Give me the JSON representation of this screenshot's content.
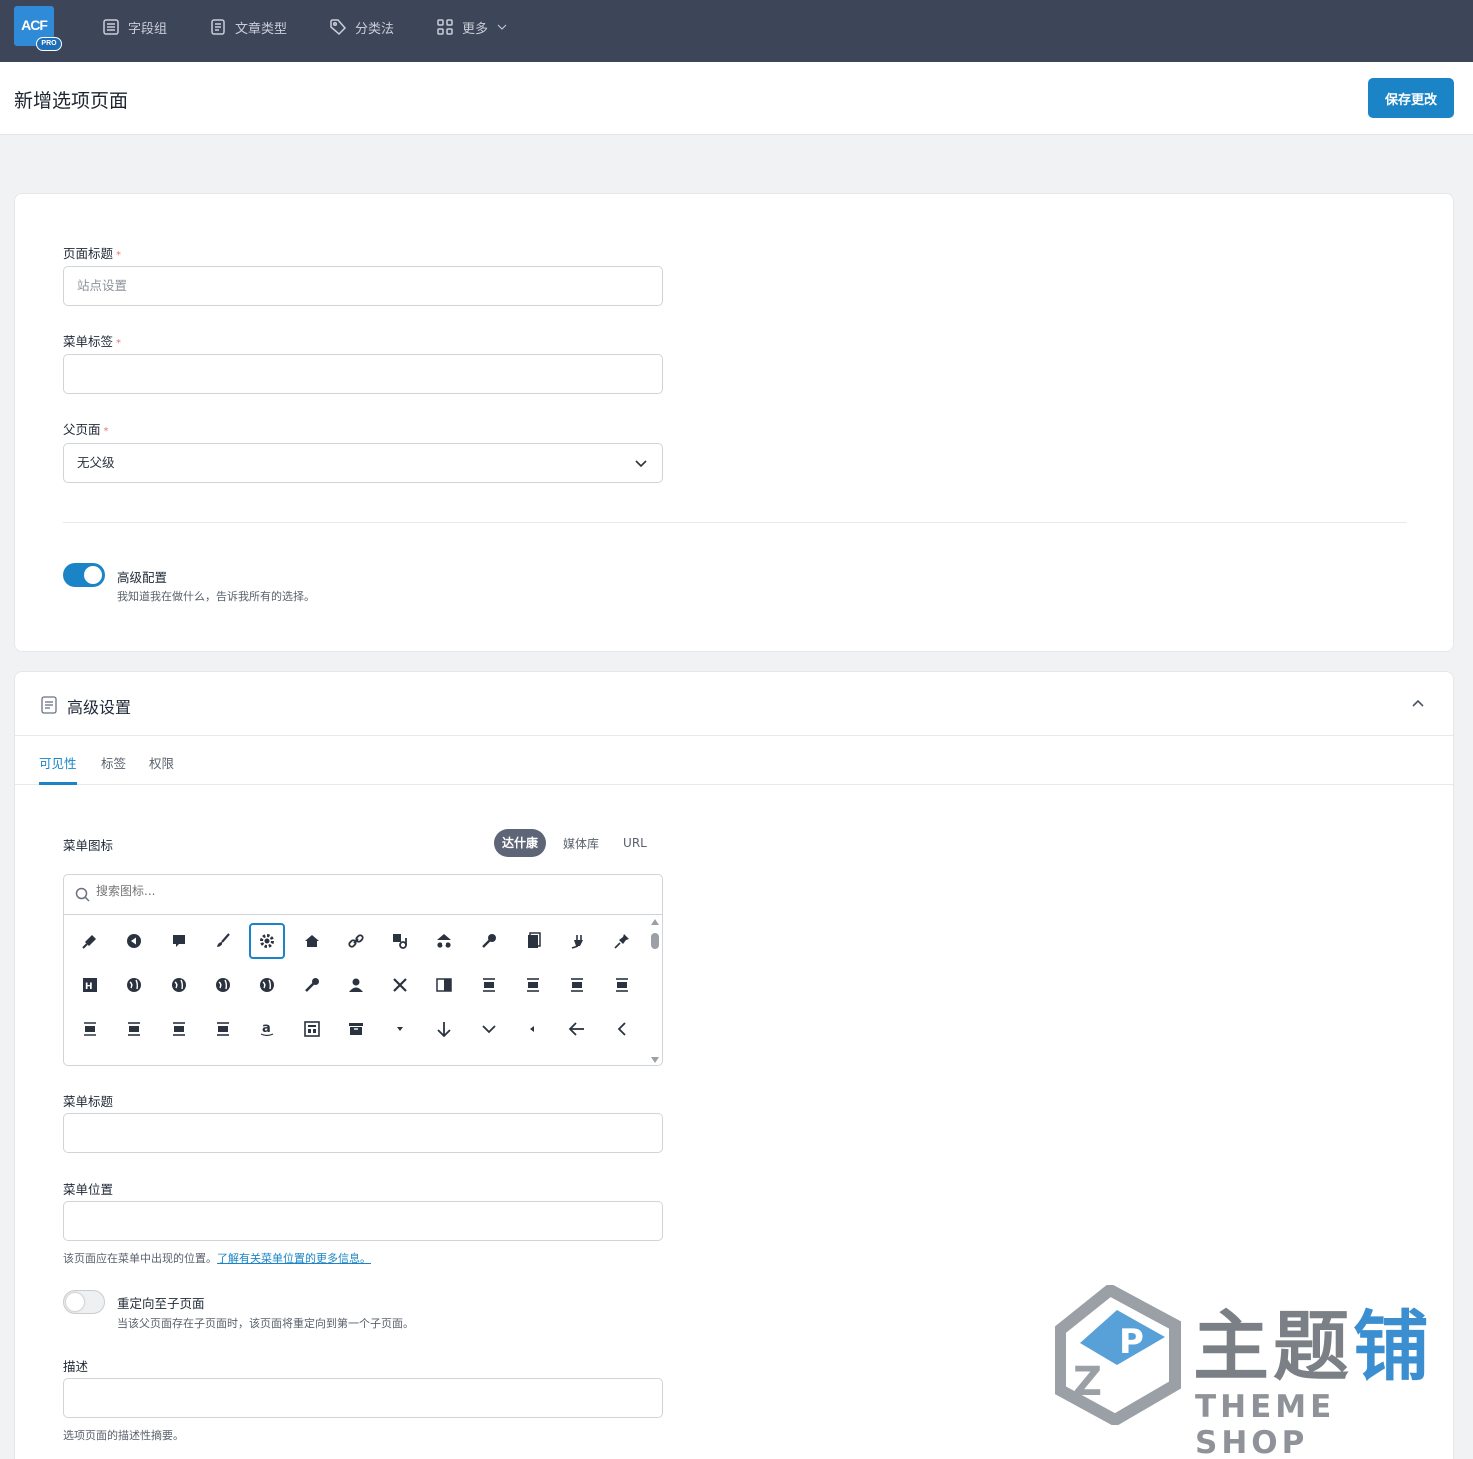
{
  "app": {
    "logo_text": "ACF",
    "logo_badge": "PRO"
  },
  "nav": [
    {
      "label": "字段组",
      "icon": "field-group-icon"
    },
    {
      "label": "文章类型",
      "icon": "post-type-icon"
    },
    {
      "label": "分类法",
      "icon": "tag-icon"
    },
    {
      "label": "更多",
      "icon": "grid-icon"
    }
  ],
  "header": {
    "title": "新增选项页面",
    "save_label": "保存更改"
  },
  "form": {
    "page_title_label": "页面标题",
    "page_title_placeholder": "站点设置",
    "menu_label_label": "菜单标签",
    "menu_label_value": "",
    "parent_label": "父页面",
    "parent_value": "无父级",
    "required_mark": "*",
    "advanced_toggle_title": "高级配置",
    "advanced_toggle_desc": "我知道我在做什么，告诉我所有的选择。",
    "advanced_toggle_on": true
  },
  "advanced": {
    "title": "高级设置",
    "tabs": [
      "可见性",
      "标签",
      "权限"
    ],
    "active_tab": 0,
    "menu_icon_label": "菜单图标",
    "icon_sources": [
      "达什康",
      "媒体库",
      "URL"
    ],
    "icon_search_placeholder": "搜索图标...",
    "icons": [
      "admin-appearance-icon",
      "back-icon",
      "comment-icon",
      "brush-icon",
      "gear-icon",
      "home-icon",
      "link-icon",
      "media-icon",
      "network-icon",
      "key-icon",
      "page-icon",
      "plugins-icon",
      "pin-icon",
      "site-icon",
      "globe-1-icon",
      "globe-2-icon",
      "globe-3-icon",
      "globe-4-icon",
      "wrench-icon",
      "user-icon",
      "airplane-icon",
      "contrast-icon",
      "align-center-icon",
      "align-full-icon",
      "align-left-icon",
      "align-none-icon",
      "align-pull-left-icon",
      "align-pull-right-icon",
      "align-right-icon",
      "align-wide-icon",
      "amazon-icon",
      "analytics-icon",
      "archive-icon",
      "arrow-down-small-icon",
      "arrow-down-icon",
      "chevron-down-icon",
      "arrow-left-small-icon",
      "arrow-left-icon",
      "chevron-left-icon"
    ],
    "selected_icon": 4,
    "menu_title_label": "菜单标题",
    "menu_title_value": "",
    "menu_position_label": "菜单位置",
    "menu_position_value": "",
    "menu_position_help": "该页面应在菜单中出现的位置。",
    "menu_position_link": "了解有关菜单位置的更多信息。",
    "redirect_title": "重定向至子页面",
    "redirect_desc": "当该父页面存在子页面时，该页面将重定向到第一个子页面。",
    "redirect_on": false,
    "description_label": "描述",
    "description_value": "",
    "description_help": "选项页面的描述性摘要。"
  },
  "watermark": {
    "cn_gray": "主题",
    "cn_blue": "铺",
    "en": "THEME SHOP"
  },
  "colors": {
    "nav_bg": "#3d4558",
    "accent": "#1b84c6",
    "pill": "#5d6577"
  }
}
